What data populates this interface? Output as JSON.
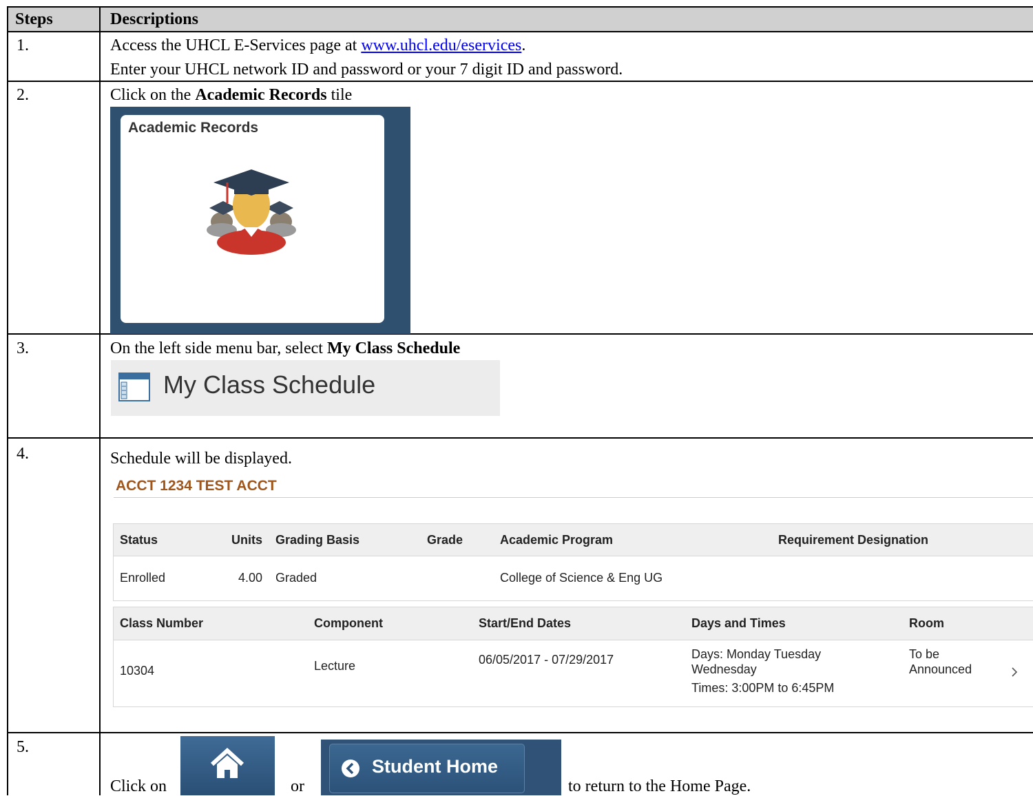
{
  "header": {
    "steps_label": "Steps",
    "descriptions_label": "Descriptions"
  },
  "step1": {
    "number": "1.",
    "line1_prefix": "Access the UHCL E-Services page at ",
    "link_text": "www.uhcl.edu/eservices",
    "line1_suffix": ".",
    "line2": "Enter your UHCL network ID and password or your 7 digit ID and password."
  },
  "step2": {
    "number": "2.",
    "prefix": "Click on the ",
    "bold": "Academic Records",
    "suffix": " tile",
    "tile_title": "Academic Records",
    "tile_icon": "graduates-icon",
    "colors": {
      "frame": "#30506f",
      "gown": "#c9342b",
      "face": "#e9b84e",
      "cap": "#2e3e52"
    }
  },
  "step3": {
    "number": "3.",
    "prefix": "On the left side menu bar, select ",
    "bold": "My Class Schedule",
    "menu_label": "My Class Schedule",
    "menu_icon": "schedule-window-icon"
  },
  "step4": {
    "number": "4.",
    "text": "Schedule will be displayed.",
    "course_title": "ACCT 1234 TEST ACCT",
    "enrollment_table": {
      "headers": [
        "Status",
        "Units",
        "Grading Basis",
        "Grade",
        "Academic Program",
        "Requirement Designation"
      ],
      "row": [
        "Enrolled",
        "4.00",
        "Graded",
        "",
        "College of Science & Eng UG",
        ""
      ]
    },
    "class_table": {
      "headers": [
        "Class Number",
        "Component",
        "Start/End Dates",
        "Days and Times",
        "Room"
      ],
      "class_number": "10304",
      "component": "Lecture",
      "dates": "06/05/2017 - 07/29/2017",
      "days_line1": "Days: Monday Tuesday",
      "days_line2": "Wednesday",
      "times": "Times: 3:00PM to 6:45PM",
      "room_line1": "To be",
      "room_line2": "Announced"
    }
  },
  "step5": {
    "number": "5.",
    "prefix": "Click on",
    "or_text": "or",
    "suffix": "to return to the Home Page.",
    "home_icon": "home-icon",
    "student_home_label": "Student Home",
    "colors": {
      "button": "#2c5279"
    }
  }
}
